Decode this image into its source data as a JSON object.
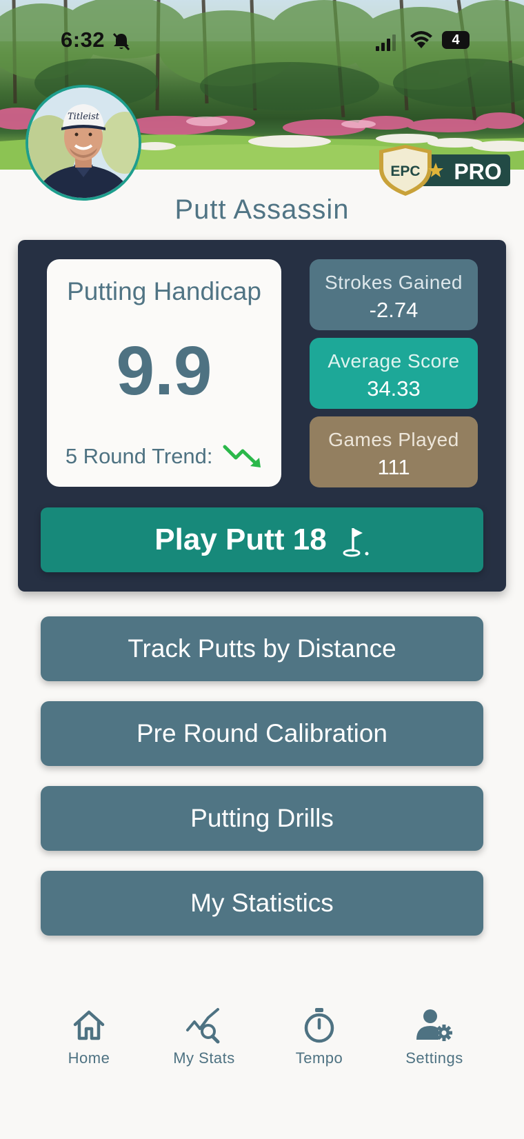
{
  "status_bar": {
    "time": "6:32",
    "battery": "4"
  },
  "profile": {
    "name": "Putt Assassin"
  },
  "badge": {
    "brand": "EPC",
    "tier": "PRO"
  },
  "handicap": {
    "title": "Putting Handicap",
    "value": "9.9",
    "trend_label": "5 Round Trend:",
    "trend_direction": "down"
  },
  "stats": [
    {
      "label": "Strokes Gained",
      "value": "-2.74"
    },
    {
      "label": "Average Score",
      "value": "34.33"
    },
    {
      "label": "Games Played",
      "value": "111"
    }
  ],
  "play_button": {
    "label": "Play Putt 18"
  },
  "menu": [
    {
      "label": "Track Putts by Distance"
    },
    {
      "label": "Pre Round Calibration"
    },
    {
      "label": "Putting Drills"
    },
    {
      "label": "My Statistics"
    }
  ],
  "tabs": [
    {
      "label": "Home",
      "icon": "home-icon"
    },
    {
      "label": "My Stats",
      "icon": "stats-search-icon"
    },
    {
      "label": "Tempo",
      "icon": "stopwatch-icon"
    },
    {
      "label": "Settings",
      "icon": "user-gear-icon"
    }
  ],
  "colors": {
    "background": "#f9f8f6",
    "panel": "#263043",
    "primary_slate": "#507584",
    "teal": "#1da898",
    "play_green": "#17897a",
    "tan": "#937f60",
    "trend_green": "#2bb84a"
  }
}
